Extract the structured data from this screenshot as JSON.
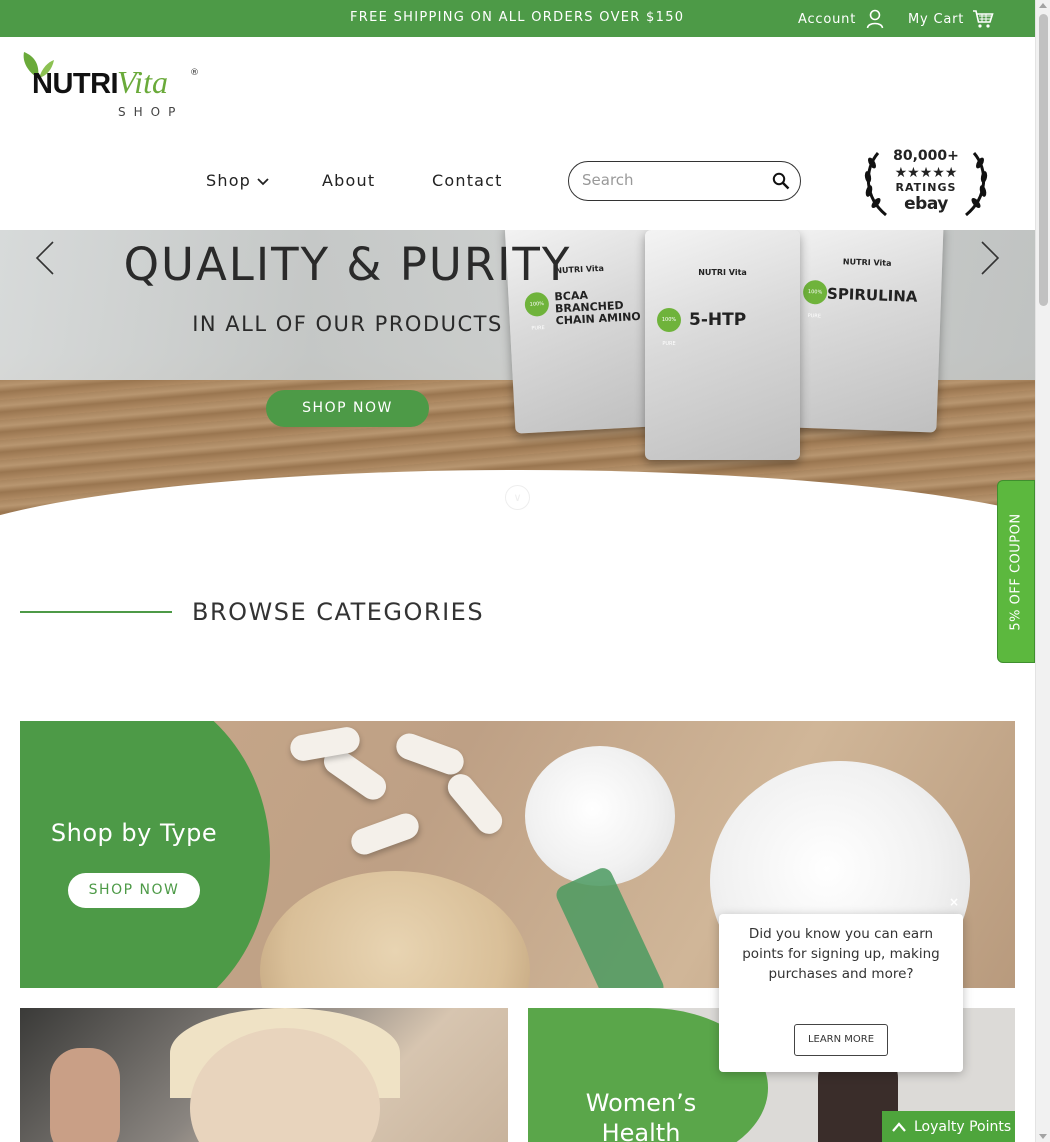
{
  "topbar": {
    "shipping_text": "FREE SHIPPING ON ALL ORDERS OVER $150",
    "account_label": "Account",
    "account_icon": "user-icon",
    "cart_label": "My Cart",
    "cart_icon": "cart-icon"
  },
  "logo": {
    "brand": "NUTRI",
    "brand_script": "Vita",
    "sub": "SHOP",
    "reg": "®"
  },
  "nav": {
    "items": [
      {
        "label": "Shop",
        "has_dropdown": true
      },
      {
        "label": "About"
      },
      {
        "label": "Contact"
      }
    ]
  },
  "search": {
    "placeholder": "Search",
    "icon": "search-icon"
  },
  "badge": {
    "count": "80,000+",
    "stars": "★★★★★",
    "label": "RATINGS",
    "platform": "ebay"
  },
  "hero": {
    "title": "QUALITY & PURITY",
    "subtitle": "IN ALL OF OUR PRODUCTS",
    "cta": "SHOP NOW",
    "products": [
      {
        "name": "BCAA BRANCHED CHAIN AMINO"
      },
      {
        "name": "5-HTP"
      },
      {
        "name": "SPIRULINA"
      }
    ],
    "bag_brand": "NUTRI Vita",
    "bag_badge": "100% PURE"
  },
  "coupon": {
    "label": "5% OFF COUPON"
  },
  "browse": {
    "title": "BROWSE CATEGORIES"
  },
  "categories": [
    {
      "title": "Shop by Type",
      "cta": "SHOP NOW"
    },
    {
      "title": ""
    },
    {
      "title": "Women’s Health"
    }
  ],
  "popup": {
    "message": "Did you know you can earn points for signing up, making purchases and more?",
    "button": "LEARN MORE",
    "close": "×"
  },
  "loyalty": {
    "label": "Loyalty Points"
  },
  "colors": {
    "brand_green": "#4d9a47",
    "coupon_green": "#5cb83e",
    "loyalty_green": "#4ea53c"
  }
}
